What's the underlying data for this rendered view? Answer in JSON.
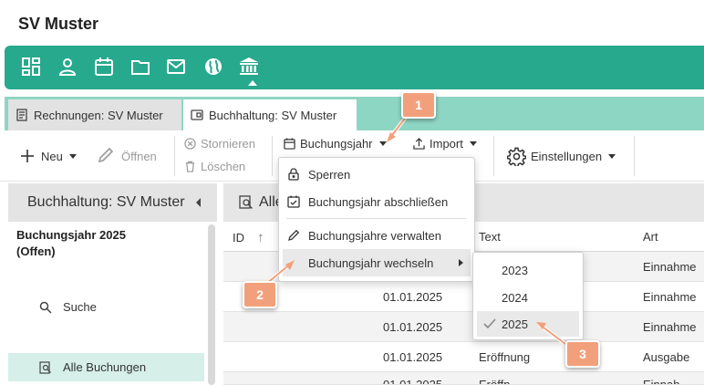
{
  "app": {
    "title": "SV Muster"
  },
  "colors": {
    "brand": "#27a98d",
    "tabstrip": "#8ed6c4",
    "badge": "#f2a07b"
  },
  "iconbar": {
    "icons": [
      "dashboard-icon",
      "user-icon",
      "calendar-icon",
      "folder-icon",
      "mail-icon",
      "globe-icon",
      "bank-icon"
    ],
    "active": "bank-icon"
  },
  "tabs": [
    {
      "label": "Rechnungen: SV Muster",
      "icon": "invoice-icon",
      "active": false
    },
    {
      "label": "Buchhaltung: SV Muster",
      "icon": "ledger-icon",
      "active": true
    }
  ],
  "toolbar": {
    "new_label": "Neu",
    "open_label": "Öffnen",
    "cancel_label": "Stornieren",
    "delete_label": "Löschen",
    "fiscal_year_label": "Buchungsjahr",
    "import_label": "Import",
    "settings_label": "Einstellungen"
  },
  "sidebar": {
    "header": "Buchhaltung: SV Muster",
    "year_line1": "Buchungsjahr 2025",
    "year_line2": "(Offen)",
    "items": [
      {
        "label": "Suche",
        "icon": "search-icon",
        "active": false
      },
      {
        "label": "Alle Buchungen",
        "icon": "list-search-icon",
        "active": true
      }
    ]
  },
  "main": {
    "title_fragment": "Alle"
  },
  "grid": {
    "columns": [
      "ID",
      "Text",
      "Art"
    ],
    "sort_indicator": "↑",
    "rows": [
      {
        "id": "",
        "date": "",
        "text": "",
        "type": "Einnahme"
      },
      {
        "id": "",
        "date": "01.01.2025",
        "text": "",
        "type": "Einnahme"
      },
      {
        "id": "",
        "date": "01.01.2025",
        "text": "",
        "type": "Einnahme"
      },
      {
        "id": "",
        "date": "01.01.2025",
        "text": "Eröffnung",
        "type": "Ausgabe"
      },
      {
        "id": "",
        "date": "01.01.2025",
        "text": "Eröffn",
        "type": "Einnah"
      }
    ]
  },
  "menu": {
    "items": [
      {
        "label": "Sperren",
        "icon": "lock-icon"
      },
      {
        "label": "Buchungsjahr abschließen",
        "icon": "calendar-check-icon"
      },
      {
        "label": "Buchungsjahre verwalten",
        "icon": "pencil-icon"
      },
      {
        "label": "Buchungsjahr wechseln",
        "icon": "",
        "has_submenu": true
      }
    ]
  },
  "submenu": {
    "years": [
      "2023",
      "2024",
      "2025"
    ],
    "selected": "2025"
  },
  "badges": [
    "1",
    "2",
    "3"
  ]
}
